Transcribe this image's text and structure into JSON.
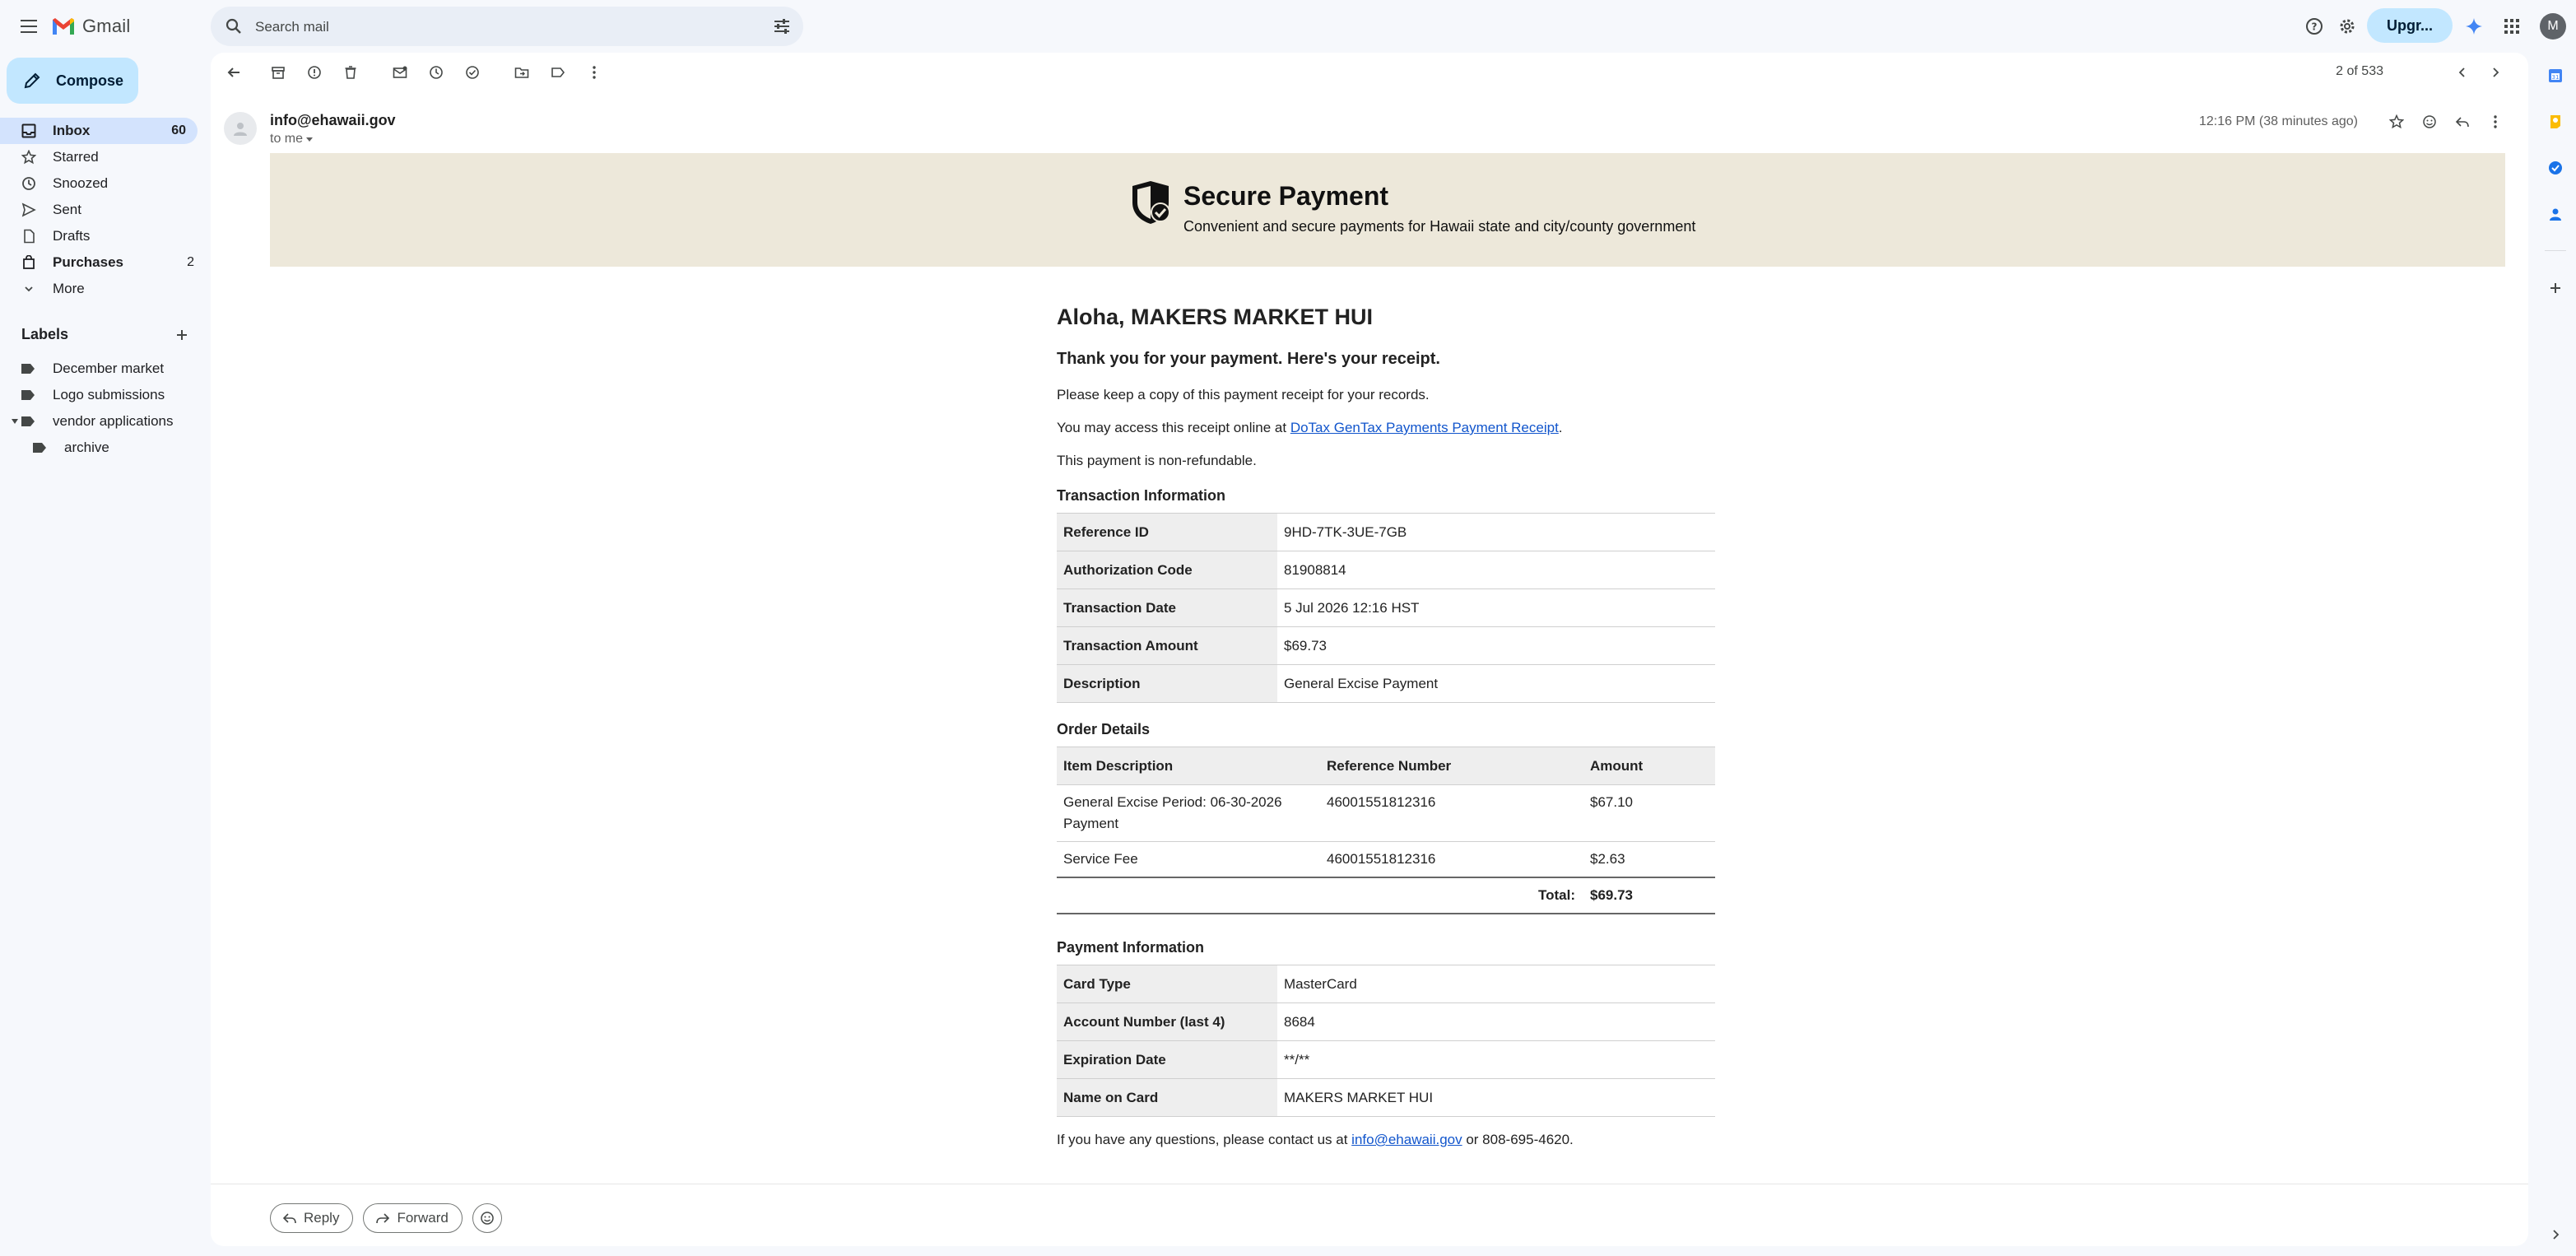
{
  "app": {
    "name": "Gmail"
  },
  "search": {
    "placeholder": "Search mail"
  },
  "topbar": {
    "upgrade_label": "Upgr...",
    "avatar_letter": "M"
  },
  "compose": {
    "label": "Compose"
  },
  "nav": [
    {
      "label": "Inbox",
      "count": "60",
      "icon": "inbox-icon"
    },
    {
      "label": "Starred",
      "count": "",
      "icon": "star-icon"
    },
    {
      "label": "Snoozed",
      "count": "",
      "icon": "clock-icon"
    },
    {
      "label": "Sent",
      "count": "",
      "icon": "send-icon"
    },
    {
      "label": "Drafts",
      "count": "",
      "icon": "draft-icon"
    },
    {
      "label": "Purchases",
      "count": "2",
      "icon": "purchases-icon"
    },
    {
      "label": "More",
      "count": "",
      "icon": "chevron-down-icon"
    }
  ],
  "labels": {
    "title": "Labels",
    "items": [
      "December market",
      "Logo submissions",
      "vendor applications",
      "archive"
    ]
  },
  "toolbar": {
    "pager": "2 of 533"
  },
  "message": {
    "sender": "info@ehawaii.gov",
    "to": "to me",
    "time": "12:16 PM (38 minutes ago)"
  },
  "banner": {
    "title": "Secure Payment",
    "subtitle": "Convenient and secure payments for Hawaii state and city/county government"
  },
  "email": {
    "greeting": "Aloha, MAKERS MARKET HUI",
    "thanks": "Thank you for your payment. Here's your receipt.",
    "keep_copy": "Please keep a copy of this payment receipt for your records.",
    "access_prefix": "You may access this receipt online at ",
    "access_link": "DoTax GenTax Payments Payment Receipt",
    "access_suffix": ".",
    "nonrefundable": "This payment is non-refundable.",
    "transaction_title": "Transaction Information",
    "transaction": [
      {
        "k": "Reference ID",
        "v": "9HD-7TK-3UE-7GB"
      },
      {
        "k": "Authorization Code",
        "v": "81908814"
      },
      {
        "k": "Transaction Date",
        "v": "5 Jul 2026 12:16 HST"
      },
      {
        "k": "Transaction Amount",
        "v": "$69.73"
      },
      {
        "k": "Description",
        "v": "General Excise Payment"
      }
    ],
    "order_title": "Order Details",
    "order_headers": [
      "Item Description",
      "Reference Number",
      "Amount"
    ],
    "order_rows": [
      {
        "desc": "General Excise Period: 06-30-2026 Payment",
        "ref": "46001551812316",
        "amount": "$67.10"
      },
      {
        "desc": "Service Fee",
        "ref": "46001551812316",
        "amount": "$2.63"
      }
    ],
    "total_label": "Total:",
    "total_value": "$69.73",
    "payment_title": "Payment Information",
    "payment": [
      {
        "k": "Card Type",
        "v": "MasterCard"
      },
      {
        "k": "Account Number (last 4)",
        "v": "8684"
      },
      {
        "k": "Expiration Date",
        "v": "**/**"
      },
      {
        "k": "Name on Card",
        "v": "MAKERS MARKET HUI"
      }
    ],
    "contact_prefix": "If you have any questions, please contact us at ",
    "contact_link": "info@ehawaii.gov",
    "contact_suffix": " or 808-695-4620."
  },
  "reply": {
    "reply_label": "Reply",
    "forward_label": "Forward"
  },
  "colors": {
    "accent": "#c2e7ff",
    "active_nav": "#d3e3fd",
    "banner_bg": "#ede8da",
    "link": "#1155cc"
  }
}
